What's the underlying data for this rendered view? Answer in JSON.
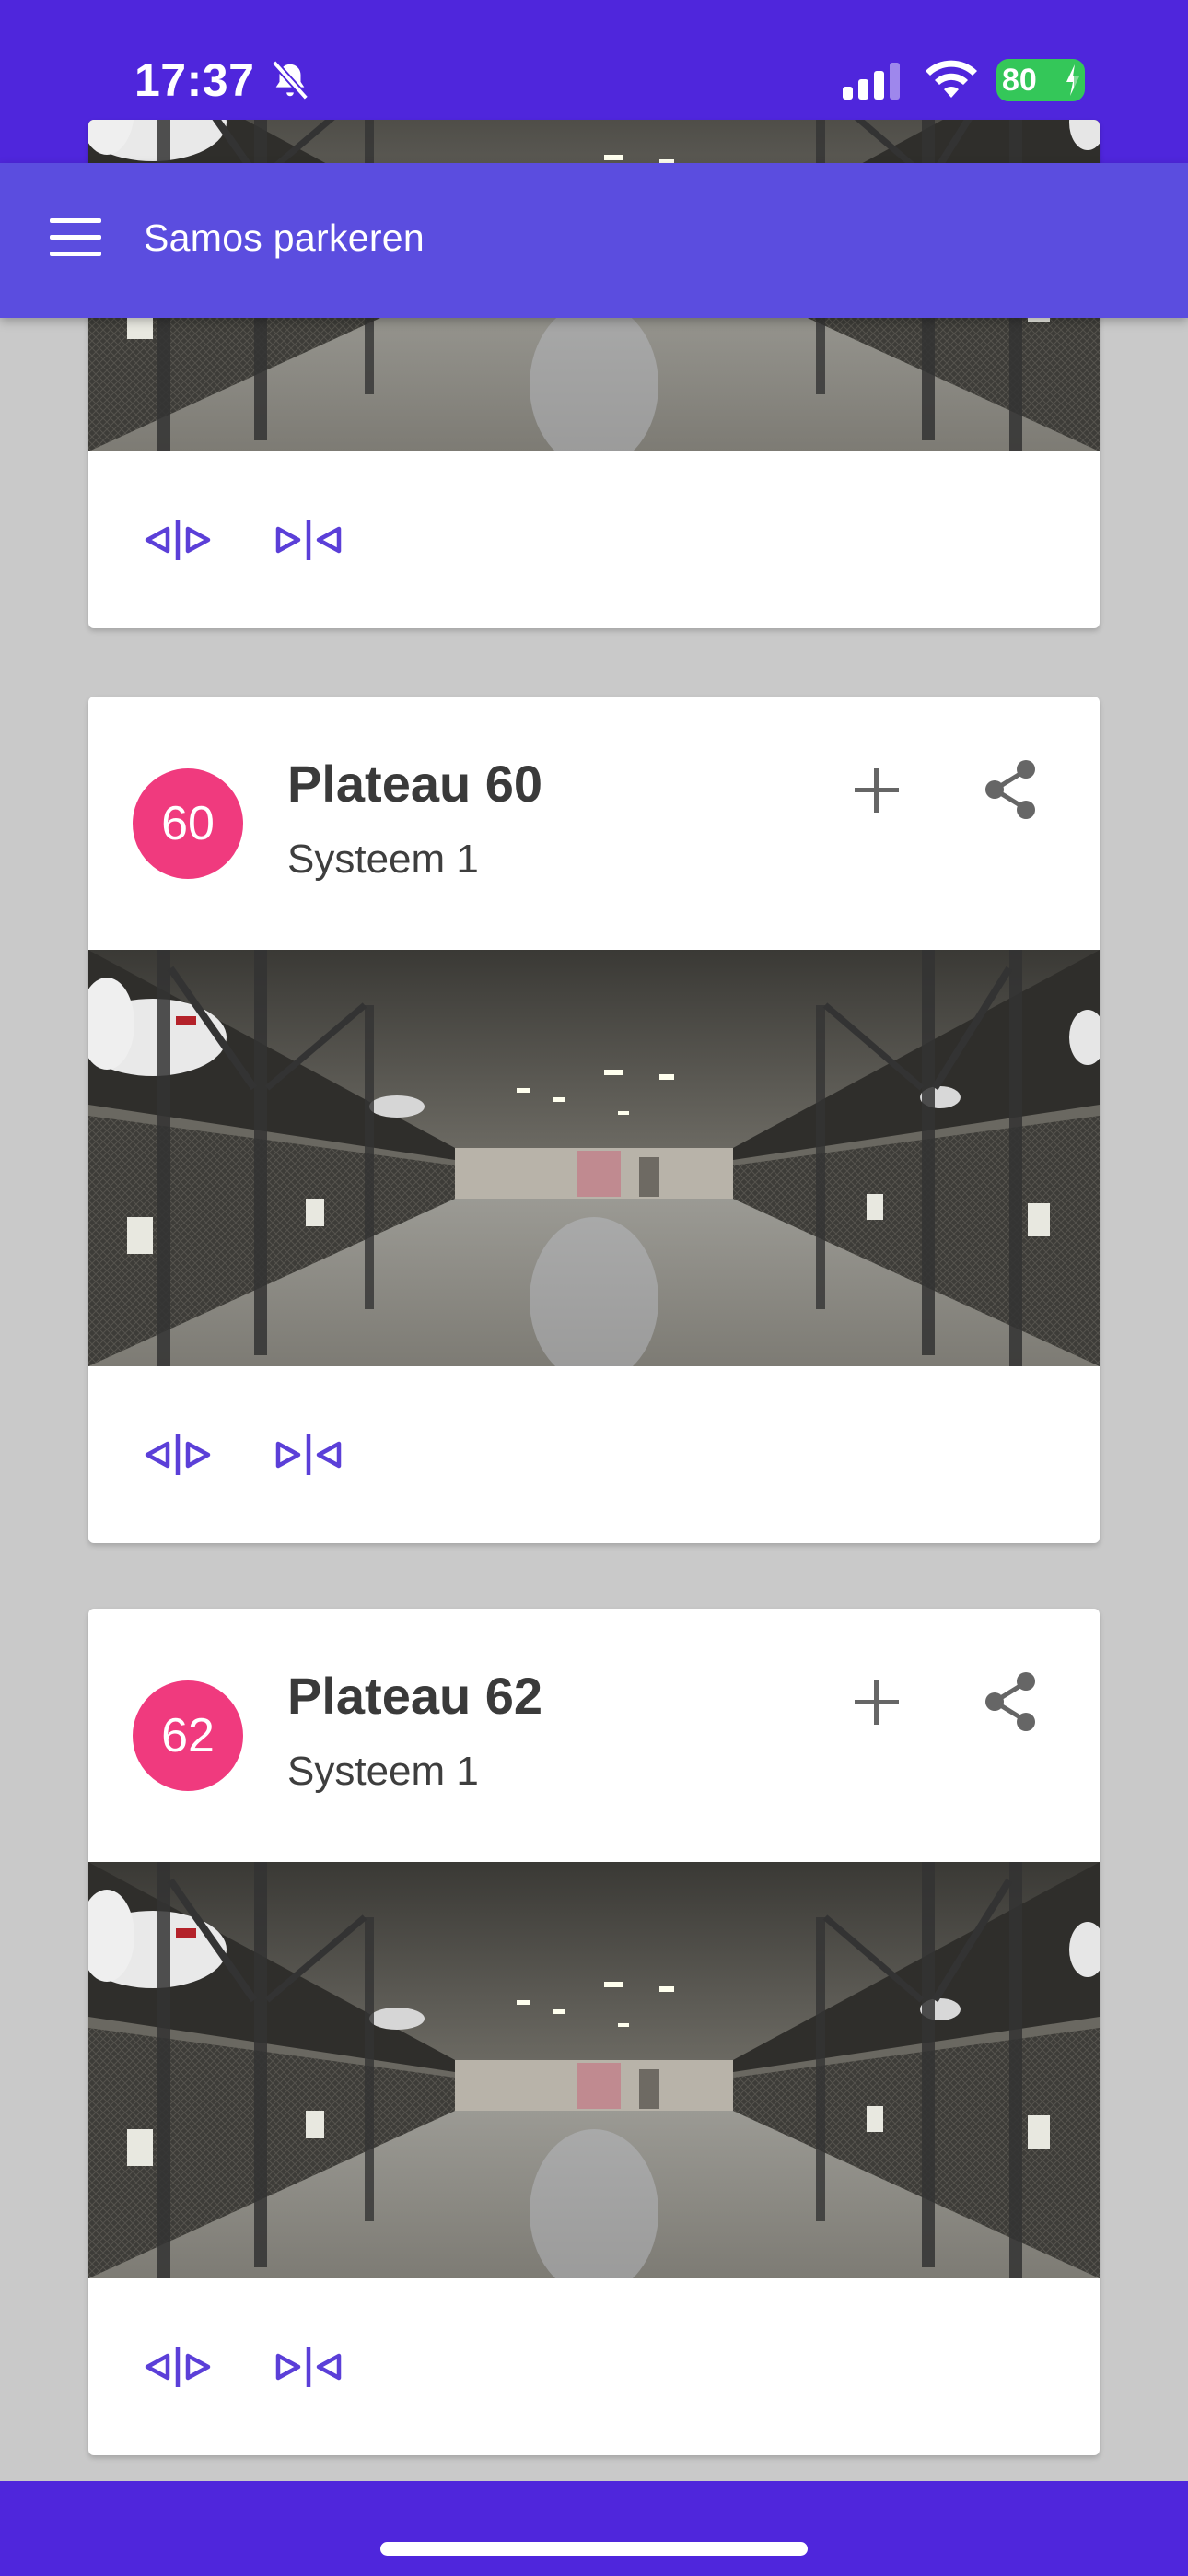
{
  "status_bar": {
    "time": "17:37",
    "battery": "80",
    "icons": [
      "bell-off-icon",
      "cellular-signal-icon",
      "wifi-icon",
      "battery-charging-icon"
    ]
  },
  "app_bar": {
    "title": "Samos parkeren",
    "menu_icon": "menu-icon"
  },
  "cards": [
    {
      "avatar": "",
      "title": "",
      "subtitle": "",
      "actions": [
        "expand-horizontal-icon",
        "collapse-horizontal-icon"
      ]
    },
    {
      "avatar": "60",
      "title": "Plateau 60",
      "subtitle": "Systeem 1",
      "header_icons": [
        "add-icon",
        "share-icon"
      ],
      "actions": [
        "expand-horizontal-icon",
        "collapse-horizontal-icon"
      ]
    },
    {
      "avatar": "62",
      "title": "Plateau 62",
      "subtitle": "Systeem 1",
      "header_icons": [
        "add-icon",
        "share-icon"
      ],
      "actions": [
        "expand-horizontal-icon",
        "collapse-horizontal-icon"
      ]
    }
  ],
  "colors": {
    "status_bar": "#4f26dc",
    "app_bar": "#5b4ddf",
    "avatar": "#f03a7e",
    "action_icon": "#5b3fd8",
    "background": "#c9c9c9",
    "battery": "#34c759"
  }
}
